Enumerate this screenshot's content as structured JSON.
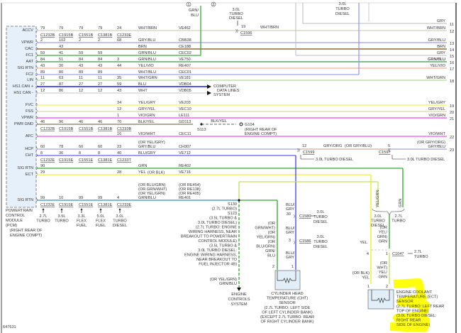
{
  "figure_id": "647631",
  "connectors": [
    "C1232B",
    "C1915B",
    "C1551B",
    "C1381B",
    "C1233E"
  ],
  "connector_rows": {
    "accv": [
      "C1232B",
      "C1915B",
      "C1551B",
      "C1381B",
      "C1233E"
    ],
    "pwr_gnd": [
      "C1232B",
      "C1915B",
      "C1551B",
      "C1381B",
      "C1233B"
    ],
    "cht": [
      "C1232E",
      "C1915E",
      "C1551E",
      "C1381E",
      "C1233T"
    ],
    "sig_rtn_bottom": [
      "C1232E",
      "C1915E",
      "C1551E",
      "C1381E",
      "C1233E"
    ]
  },
  "engine_variants": [
    "2.7L TURBO",
    "3.5L TURBO",
    "3.3L FLEX FUEL",
    "5.0L FLEX FUEL",
    "3.0L TURBO DIESEL"
  ],
  "rows": [
    {
      "pin": "ACCV",
      "pins": [
        "79",
        "79",
        "79",
        "79",
        "24"
      ],
      "wire": "WHT/BRN",
      "circuit": "VE462",
      "right_label": "WHT/BRN",
      "right_no": "12",
      "color": "#d8cfbd"
    },
    {
      "pin": "VPWR",
      "pins": [
        "2",
        "102",
        "2",
        "2",
        "68"
      ],
      "wire": "GRY/BLU",
      "circuit": "CBB38",
      "right_label": "GRY/BLU",
      "right_no": "13",
      "color": "#9c9cf0"
    },
    {
      "pin": "CAC",
      "pins": [
        "",
        "43",
        "",
        "",
        ""
      ],
      "wire": "BRN",
      "circuit": "CE188",
      "right_label": "BRN",
      "right_no": "14",
      "color": "#7a4a10"
    },
    {
      "pin": "FC1",
      "pins": [
        "59",
        "41",
        "59",
        "59",
        ""
      ],
      "wire": "GRN/BLU",
      "circuit": "CEC02",
      "right_label": "",
      "right_no": "",
      "color": "#3aa63a"
    },
    {
      "pin": "AAT",
      "pins": [
        "84",
        "51",
        "84",
        "84",
        "3"
      ],
      "wire": "GRN/BLU",
      "circuit": "VE750",
      "right_label": "GRN/BLU",
      "right_no": "16",
      "color": "#2f9f3f"
    },
    {
      "pin": "SIG RTN",
      "pins": [
        "43",
        "30",
        "43",
        "43",
        "44"
      ],
      "wire": "YEL/VIO",
      "circuit": "RE407",
      "right_label": "YEL/VIO",
      "right_no": "17",
      "color": "#f4b090"
    },
    {
      "pin": "FC2",
      "pins": [
        "89",
        "80",
        "89",
        "89",
        ""
      ],
      "wire": "WHT/BLU",
      "circuit": "CEC01",
      "right_label": "",
      "right_no": "",
      "color": "#a0a0f0"
    },
    {
      "pin": "LIN",
      "pins": [
        "11",
        "63",
        "11",
        "11",
        "35"
      ],
      "wire": "WHT/GRN",
      "circuit": "VE181",
      "right_label": "WHT/GRN",
      "right_no": "18",
      "color": "#b9d7a0"
    },
    {
      "pin": "HS1 CAN +",
      "pins": [
        "27",
        "87",
        "27",
        "27",
        "59"
      ],
      "wire": "BLU",
      "circuit": "VDB04",
      "right_label": "",
      "right_no": "",
      "color": "#1a1aee"
    },
    {
      "pin": "HS1 CAN -",
      "pins": [
        "12",
        "86",
        "12",
        "12",
        "43"
      ],
      "wire": "WHT",
      "circuit": "VDB05",
      "right_label": "",
      "right_no": "",
      "color": "#d0d0d0"
    },
    {
      "pin": "FVC",
      "pins": [
        "",
        "",
        "",
        "",
        "34"
      ],
      "wire": "YEL/GRY",
      "circuit": "VE203",
      "right_label": "YEL/GRY",
      "right_no": "19",
      "color": "#f2f250"
    },
    {
      "pin": "FSS",
      "pins": [
        "",
        "",
        "",
        "",
        "12"
      ],
      "wire": "GRY/YEL",
      "circuit": "VEC10",
      "right_label": "GRY/YEL",
      "right_no": "20",
      "color": "#d6d6a6"
    },
    {
      "pin": "VPWR",
      "pins": [
        "",
        "",
        "",
        "",
        "1"
      ],
      "wire": "VIO/GRN",
      "circuit": "LE111",
      "right_label": "VIO/GRN",
      "right_no": "21",
      "color": "#ee44ee"
    },
    {
      "pin": "PWR GND",
      "pins": [
        "46",
        "96",
        "46",
        "46",
        "70"
      ],
      "wire": "BLK/YEL",
      "circuit": "GD113",
      "right_label": "",
      "right_no": "",
      "color": "#807a50"
    },
    {
      "pin": "AFC",
      "pins": [
        "",
        "",
        "",
        "",
        "16"
      ],
      "wire": "VIO/WHT",
      "circuit": "CEC11",
      "right_label": "VIO/WHT",
      "right_no": "22",
      "color": "#f050f0"
    },
    {
      "pin": "HCP",
      "pins": [
        "60",
        "78",
        "60",
        "60",
        "23"
      ],
      "wire": "GRY/BLU",
      "wire_alt": "(OR YEL/GRY)",
      "circuit": "CH307",
      "right_label": "GRY/BLU",
      "right_label_alt": "(OR GRY/ORG)",
      "right_no": "23",
      "color": "#b0b0e0"
    },
    {
      "pin": "CHT",
      "pins": [
        "8",
        "36",
        "8",
        "8",
        "40"
      ],
      "wire": "BLU/GRY",
      "circuit": "VE712",
      "right_label": "",
      "right_no": "",
      "color": "#6060f0"
    },
    {
      "pin": "SIG RTN",
      "pins": [
        "90",
        "",
        "",
        "",
        ""
      ],
      "wire": "GRN",
      "circuit": "RE402",
      "right_label": "",
      "right_no": "",
      "color": "#2fa62f"
    },
    {
      "pin": "ECT",
      "pins": [
        "29",
        "",
        "",
        "",
        "28"
      ],
      "wire": "YEL",
      "wire_alt": "(OR BLK)",
      "circuit": "VE716",
      "right_label": "",
      "right_no": "",
      "color": "#f2f230"
    },
    {
      "pin": "SIG RTN",
      "pins": [
        "99",
        "10",
        "99",
        "99",
        "4"
      ],
      "wire": "GRN/BLU",
      "wire_alt": [
        "(OR BLU/GRN)",
        "(OR GRN/WHT)",
        "(OR YEL/GRN)"
      ],
      "circuit": "RE401",
      "circuit_alt": [
        "(OR RE454)",
        "(OR RE138)",
        "(OR RE405)"
      ],
      "right_label": "",
      "right_no": "",
      "color": "#2f8fd0"
    }
  ],
  "top": {
    "marker1": "1",
    "marker2": "2",
    "fc1_wire": "GRN/BLU",
    "c1596_note": "3.0L TURBO DIESEL",
    "c1596": "C1596",
    "c1596_pin": "19",
    "c1596_wire": "WHT/BRN",
    "gry_note": "3.0L TURBO DIESEL",
    "gry11": "GRY",
    "no11": "11",
    "gry15": "GRY",
    "no15": "15",
    "grnblu16": "GRN/BLU"
  },
  "data_lines": "COMPUTER DATA LINES SYSTEM",
  "ground": {
    "splice": "S113",
    "wire": "BLK/YEL",
    "g": "G104",
    "location": "(RIGHT REAR OF ENGINE COMPT)"
  },
  "hcp_path": {
    "c1599": "C1599",
    "c1599_pin": "12",
    "wire": "GRY/ORG",
    "wire_alt": "(OR GRY/BLU)",
    "c1597": "C1597",
    "c1597_pin": "5",
    "note": "3.0L TURBO DIESEL"
  },
  "pcm": {
    "name": "POWERTRAIN CONTROL MODULE (PCM)",
    "location": "(RIGHT REAR OF ENGINE COMPT)"
  },
  "splice_note": [
    "S130",
    "(2.7L TURBO)",
    "S123",
    "(3.5L TURBO &",
    "3.0L TURBO DIESEL)",
    "(2.7L TURBO: ENGINE",
    "WIRING HARNESS, NEAR",
    "BREAKOUT TO POWERTRAIN",
    "CONTROL MODULE)",
    "(3.5L TURBO &",
    "3.0L TURBO DIESEL:",
    "ENGINE WIRING HARNESS,",
    "NEAR BREAKOUT TO",
    "FUEL INJECTOR 4B)"
  ],
  "ecs": {
    "wire_alt": "(OR YEL/GRN)",
    "wire": "GRN/BLU",
    "label": "ENGINE CONTROLS SYSTEM"
  },
  "cht_sensor": {
    "pin1_wire": "BLU/GRY",
    "c1580": "C1580",
    "c1580_pin": "30",
    "c1586": "C1586",
    "c1586_pin": "3",
    "note": "3.0L TURBO DIESEL",
    "pin2_wire": [
      "(OR",
      "GRN/WHT)",
      "(OR",
      "YEL/GRN)",
      "(OR",
      "BLU/GRN)",
      "GRN/",
      "BLU"
    ],
    "pin1": "1",
    "pin2": "2",
    "label": [
      "CYLINDER HEAD",
      "TEMPERATURE (CHT)",
      "SENSOR",
      "(2.7L TURBO: LEFT SIDE",
      "OF LEFT CYLINDER BANK)",
      "(EXCEPT 2.7L TURBO: REAR",
      "OF RIGHT CYLINDER BANK)"
    ]
  },
  "ect_sensor": {
    "yelgrn": "YEL/GRN",
    "grn": "GRN",
    "brace_left": "3.0L TURBO DIESEL",
    "brace_right": "2.7L TURBO",
    "upper_alt": [
      "(OR",
      "YEL/",
      "GRN)",
      "GRN"
    ],
    "yel": "YEL",
    "c1047": "C1047",
    "c1047_pin1": "1",
    "c1047_pin4": "4",
    "c1047_note": "2.7L TURBO",
    "lower_alt": [
      "(OR",
      "WHT)",
      "YEL/",
      "GRN"
    ],
    "pin1_wire": [
      "(OR BLK)",
      "YEL"
    ],
    "pin1": "1",
    "pin2": "2",
    "label": [
      "ENGINE COOLANT",
      "TEMPERATURE (ECT)",
      "SENSOR",
      "(2.7L TURBO: LEFT REAR",
      "TOP OF ENGINE)",
      "(3.0L TURBO DIESEL:",
      "RIGHT REAR",
      "SIDE OF ENGINE)"
    ],
    "highlight": "#ffff00"
  }
}
